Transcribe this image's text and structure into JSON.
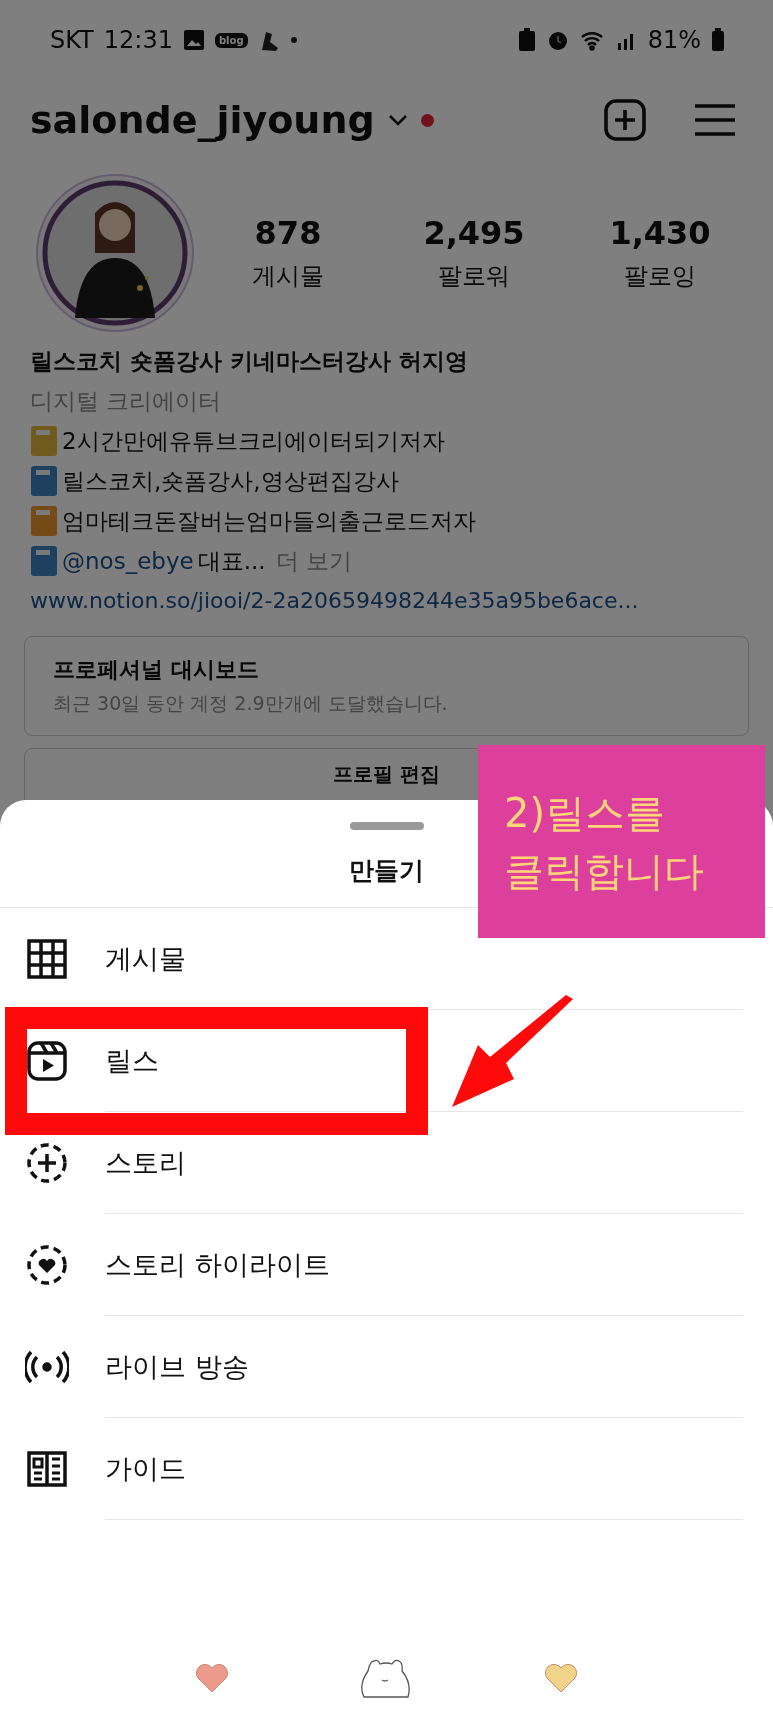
{
  "status_bar": {
    "carrier": "SKT",
    "time": "12:31",
    "notification_badge": "blog",
    "battery": "81%"
  },
  "header": {
    "username": "salonde_jiyoung",
    "notification_dot": true
  },
  "stats": [
    {
      "value": "878",
      "label": "게시물"
    },
    {
      "value": "2,495",
      "label": "팔로워"
    },
    {
      "value": "1,430",
      "label": "팔로잉"
    }
  ],
  "profile": {
    "name": "릴스코치 숏폼강사 키네마스터강사 허지영",
    "category": "디지털 크리에이터",
    "bio": [
      {
        "text": "2시간만에유튜브크리에이터되기저자",
        "color": "#705a1d"
      },
      {
        "text": "릴스코치,숏폼강사,영상편집강사",
        "color": "#1e4162"
      },
      {
        "text": "엄마테크돈잘버는엄마들의출근로드저자",
        "color": "#744b17"
      }
    ],
    "last_line": {
      "color": "#1e4162",
      "mention": "@nos_ebye",
      "text": "대표...",
      "more": "더 보기"
    },
    "link": "www.notion.so/jiooi/2-2a20659498244e35a95be6ace..."
  },
  "dashboard": {
    "title": "프로페셔널 대시보드",
    "subtitle": "최근 30일 동안 계정 2.9만개에 도달했습니다."
  },
  "edit_button": "프로필 편집",
  "sheet": {
    "title": "만들기",
    "items": [
      {
        "label": "게시물",
        "kind": "grid",
        "highlighted": false
      },
      {
        "label": "릴스",
        "kind": "reels",
        "highlighted": true
      },
      {
        "label": "스토리",
        "kind": "story",
        "highlighted": false
      },
      {
        "label": "스토리 하이라이트",
        "kind": "highlight",
        "highlighted": false
      },
      {
        "label": "라이브 방송",
        "kind": "live",
        "highlighted": false
      },
      {
        "label": "가이드",
        "kind": "guide",
        "highlighted": false
      }
    ]
  },
  "annotation": {
    "lines": [
      "2)릴스를",
      "클릭합니다"
    ]
  },
  "stickers": [
    {
      "kind": "heart",
      "color": "#eb9a8c"
    },
    {
      "kind": "bear"
    },
    {
      "kind": "heart",
      "color": "#f2d38a"
    }
  ]
}
